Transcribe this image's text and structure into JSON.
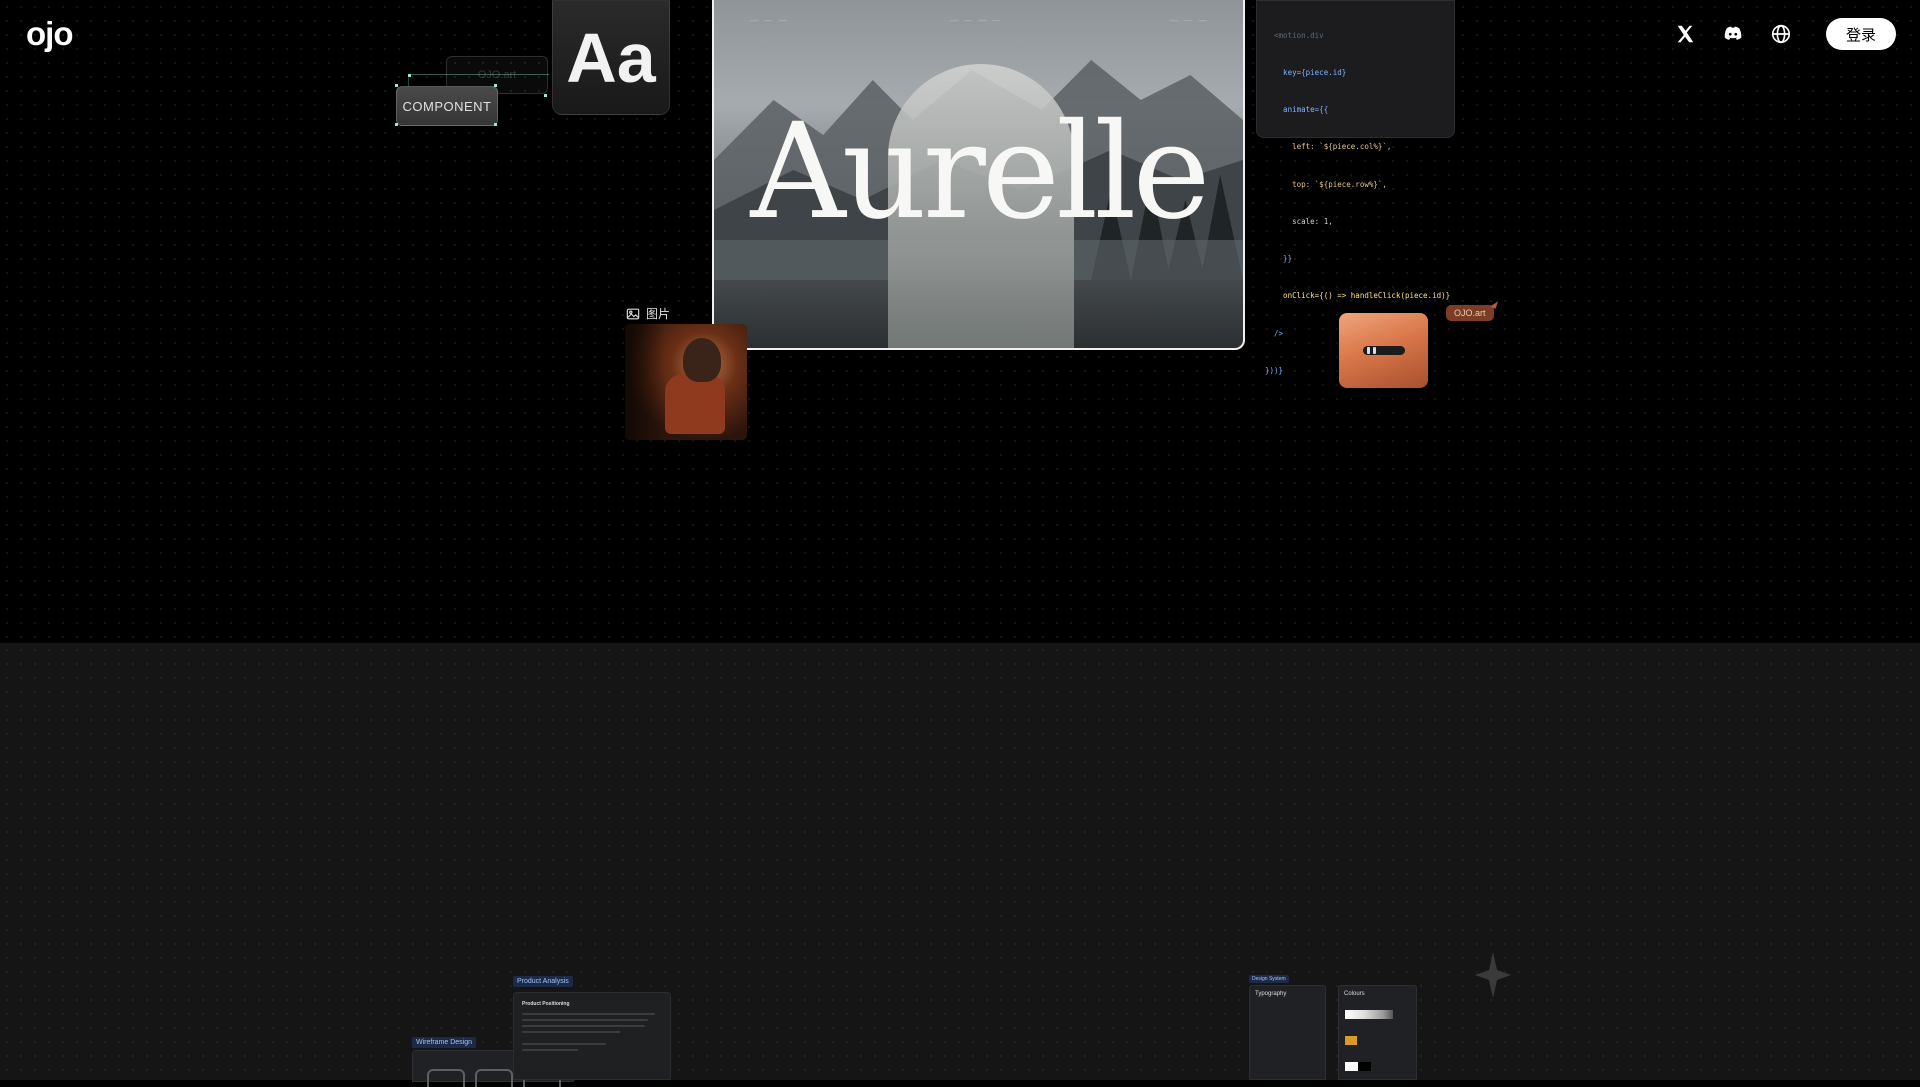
{
  "header": {
    "logo_text": "ojo",
    "icons": [
      "x-icon",
      "discord-icon",
      "globe-icon"
    ],
    "login_label": "登录"
  },
  "hero": {
    "component_chip_label": "COMPONENT",
    "ghost_chip_label": "OJO.art",
    "typeface_sample": "Aa",
    "brand_title": "Aurelle",
    "image_label": "图片",
    "tag_label": "OJO.art",
    "code_lines": [
      "  <motion.div",
      "    key={piece.id}",
      "    animate={{",
      "      left: `${piece.col%}`,",
      "      top: `${piece.row%}`,",
      "      scale: 1,",
      "    }}",
      "    onClick={() => handleClick(piece.id)}",
      "  />",
      "}))}"
    ]
  },
  "lower": {
    "wireframe_label": "Wireframe Design",
    "product_label": "Product Analysis",
    "product_heading": "Product Positioning",
    "design_label": "Design System",
    "typography_heading": "Typography",
    "colours_heading": "Colours"
  },
  "colors": {
    "accent_orange": "#d9774a",
    "selection_green": "#9fe7cf",
    "tag_bg": "#7b3d25"
  }
}
